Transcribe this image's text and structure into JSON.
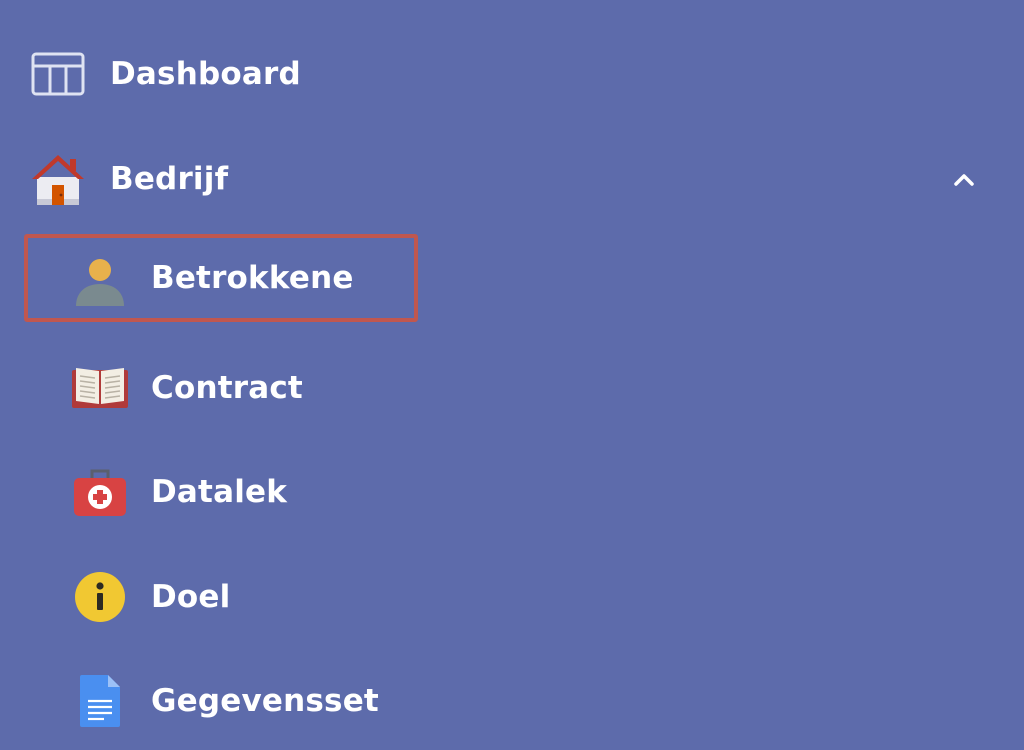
{
  "sidebar": {
    "items": [
      {
        "label": "Dashboard",
        "icon": "dashboard-layout-icon"
      },
      {
        "label": "Bedrijf",
        "icon": "house-icon",
        "expanded": true,
        "chevron_icon": "chevron-up-icon"
      }
    ],
    "subitems": [
      {
        "label": "Betrokkene",
        "icon": "person-icon",
        "selected": true
      },
      {
        "label": "Contract",
        "icon": "open-book-icon"
      },
      {
        "label": "Datalek",
        "icon": "first-aid-kit-icon"
      },
      {
        "label": "Doel",
        "icon": "info-icon"
      },
      {
        "label": "Gegevensset",
        "icon": "document-icon"
      }
    ]
  },
  "colors": {
    "background": "#5d6bab",
    "text": "#ffffff",
    "selection_outline": "#c0574f"
  }
}
